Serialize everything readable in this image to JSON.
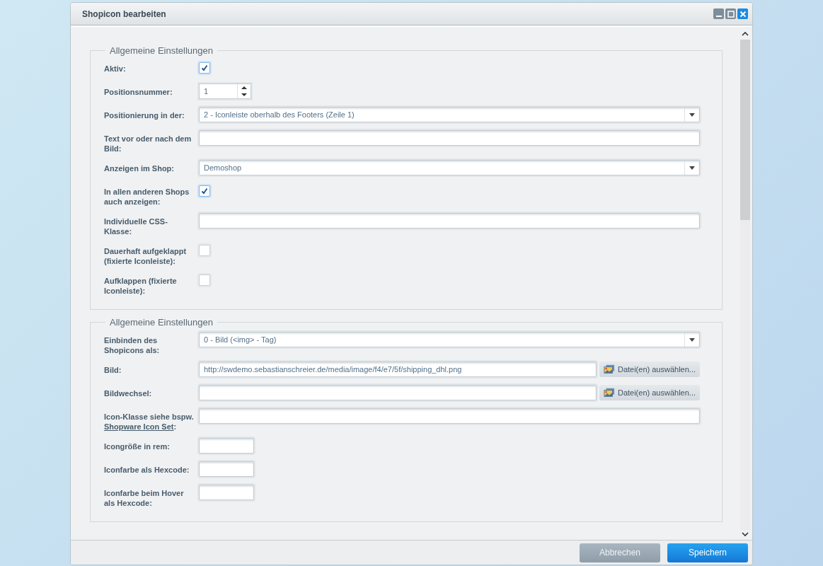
{
  "window": {
    "title": "Shopicon bearbeiten"
  },
  "sections": [
    {
      "legend": "Allgemeine Einstellungen",
      "fields": [
        {
          "kind": "checkbox",
          "label": "Aktiv:",
          "checked": true
        },
        {
          "kind": "spinner",
          "label": "Positionsnummer:",
          "value": "1"
        },
        {
          "kind": "combo",
          "label": "Positionierung in der:",
          "value": "2 - Iconleiste oberhalb des Footers (Zeile 1)"
        },
        {
          "kind": "text",
          "label": "Text vor oder nach dem Bild:"
        },
        {
          "kind": "combo",
          "label": "Anzeigen im Shop:",
          "value": "Demoshop"
        },
        {
          "kind": "checkbox",
          "label": "In allen anderen Shops auch anzeigen:",
          "checked": true
        },
        {
          "kind": "text",
          "label": "Individuelle CSS-Klasse:"
        },
        {
          "kind": "checkbox",
          "label": "Dauerhaft aufgeklappt (fixierte Iconleiste):",
          "checked": false
        },
        {
          "kind": "checkbox",
          "label": "Aufklappen (fixierte Iconleiste):",
          "checked": false
        }
      ]
    },
    {
      "legend": "Allgemeine Einstellungen",
      "fields": [
        {
          "kind": "combo",
          "label": "Einbinden des Shopicons als:",
          "value": "0 - Bild (<img> - Tag)"
        },
        {
          "kind": "file",
          "label": "Bild:",
          "value": "http://swdemo.sebastianschreier.de/media/image/f4/e7/5f/shipping_dhl.png",
          "button": "Datei(en) auswählen..."
        },
        {
          "kind": "file",
          "label": "Bildwechsel:",
          "button": "Datei(en) auswählen..."
        },
        {
          "kind": "text",
          "label": "Icon-Klasse siehe bspw.",
          "link": "Shopware Icon Set",
          "label_after": ":"
        },
        {
          "kind": "small",
          "label": "Icongröße in rem:"
        },
        {
          "kind": "small",
          "label": "Iconfarbe als Hexcode:"
        },
        {
          "kind": "small",
          "label": "Iconfarbe beim Hover als Hexcode:"
        }
      ]
    }
  ],
  "buttons": [
    {
      "label": "Abbrechen",
      "kind": "secondary"
    },
    {
      "label": "Speichern",
      "kind": "primary"
    }
  ]
}
